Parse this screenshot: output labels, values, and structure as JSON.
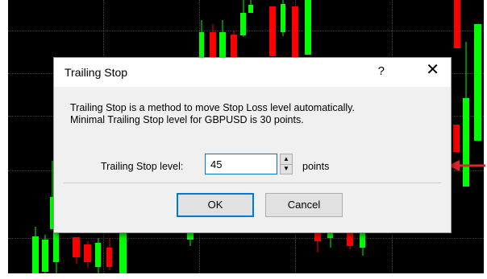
{
  "dialog": {
    "title": "Trailing Stop",
    "help_icon_glyph": "?",
    "close_icon_glyph": "✕",
    "description_line1": "Trailing Stop is a method to move Stop Loss level automatically.",
    "description_line2": "Minimal Trailing Stop level for GBPUSD is 30 points.",
    "level_label": "Trailing Stop level:",
    "level_value": "45",
    "level_unit": "points",
    "ok_label": "OK",
    "cancel_label": "Cancel"
  },
  "colors": {
    "chart_background": "#000000",
    "bull_candle": "#00ff00",
    "bear_candle": "#ff0000",
    "focus_accent": "#0078d7",
    "annotation_arrow": "#e0262f"
  },
  "icons": {
    "help": "question-mark-icon",
    "close": "close-icon",
    "spin_up": "triangle-up-icon",
    "spin_down": "triangle-down-icon",
    "annotation": "left-arrow-icon"
  }
}
